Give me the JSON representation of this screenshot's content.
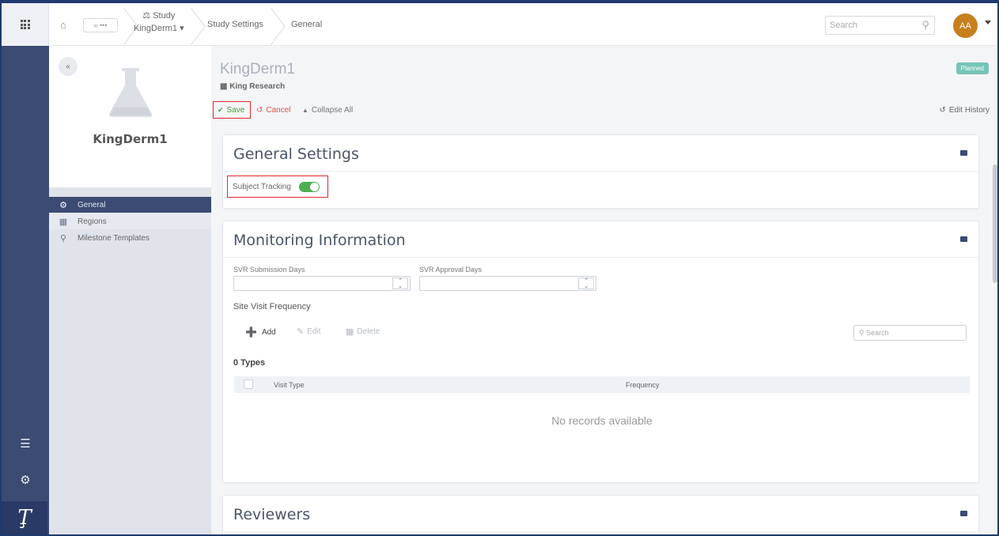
{
  "rail": {
    "apps_icon": "grid-icon",
    "list_icon": "list-icon",
    "settings_icon": "gear-icon",
    "logo_glyph": "Ţ"
  },
  "topbar": {
    "back_label": "« •••",
    "study_label": "Study",
    "study_name": "KingDerm1",
    "breadcrumbs": [
      "Study Settings",
      "General"
    ],
    "search_placeholder": "Search",
    "avatar_initials": "AA",
    "avatar_color": "#c87f1e"
  },
  "sidebar": {
    "collapse_label": "«",
    "title": "KingDerm1",
    "items": [
      {
        "label": "General",
        "icon": "gear-icon",
        "active": true
      },
      {
        "label": "Regions",
        "icon": "map-icon",
        "active": false
      },
      {
        "label": "Milestone Templates",
        "icon": "pin-icon",
        "active": false
      }
    ]
  },
  "page": {
    "title": "KingDerm1",
    "organization": "King Research",
    "status_badge": "Planned",
    "actions": {
      "save": "Save",
      "cancel": "Cancel",
      "collapse_all": "Collapse All",
      "edit_history": "Edit History"
    }
  },
  "general_settings": {
    "heading": "General Settings",
    "subject_tracking_label": "Subject Tracking",
    "subject_tracking_on": true
  },
  "monitoring": {
    "heading": "Monitoring Information",
    "svr_submission_label": "SVR Submission Days",
    "svr_approval_label": "SVR Approval Days",
    "svr_submission_value": "",
    "svr_approval_value": "",
    "site_visit_frequency": "Site Visit Frequency",
    "toolbar": {
      "add": "Add",
      "edit": "Edit",
      "delete": "Delete"
    },
    "grid_search_placeholder": "Search",
    "type_count": "0 Types",
    "columns": [
      "Visit Type",
      "Frequency"
    ],
    "empty_message": "No records available"
  },
  "reviewers": {
    "heading": "Reviewers"
  },
  "colors": {
    "navy": "#3b4b72",
    "accent_green": "#4caf50",
    "danger": "#d9534f",
    "badge": "#76c4b8"
  }
}
